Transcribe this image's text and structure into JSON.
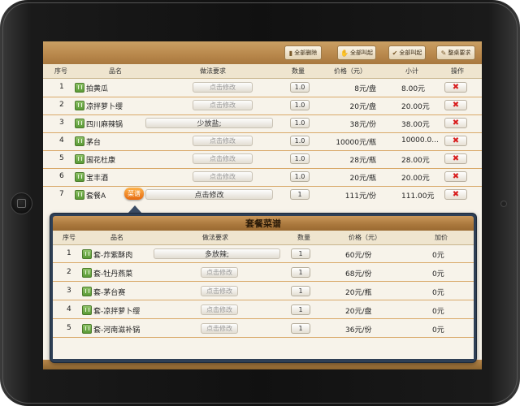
{
  "toolbar": {
    "delete_all": "全部删除",
    "hold_all": "全部叫起",
    "call_all": "全部叫起",
    "table_request": "整桌要求"
  },
  "columns": {
    "no": "序号",
    "name": "品名",
    "request": "做法要求",
    "qty": "数量",
    "price": "价格（元）",
    "subtotal": "小计",
    "action": "操作"
  },
  "orders": [
    {
      "no": "1",
      "name": "拍黄瓜",
      "request": "点击修改",
      "qty": "1.0",
      "price": "8元/盘",
      "subtotal": "8.00元"
    },
    {
      "no": "2",
      "name": "凉拌萝卜缨",
      "request": "点击修改",
      "qty": "1.0",
      "price": "20元/盘",
      "subtotal": "20.00元"
    },
    {
      "no": "3",
      "name": "四川麻辣锅",
      "request": "少放盐;",
      "qty": "1.0",
      "price": "38元/份",
      "subtotal": "38.00元"
    },
    {
      "no": "4",
      "name": "茅台",
      "request": "点击修改",
      "qty": "1.0",
      "price": "10000元/瓶",
      "subtotal": "10000.0..."
    },
    {
      "no": "5",
      "name": "国花杜康",
      "request": "点击修改",
      "qty": "1.0",
      "price": "28元/瓶",
      "subtotal": "28.00元"
    },
    {
      "no": "6",
      "name": "宝丰酒",
      "request": "点击修改",
      "qty": "1.0",
      "price": "20元/瓶",
      "subtotal": "20.00元"
    },
    {
      "no": "7",
      "name": "套餐A",
      "request": "点击修改",
      "qty": "1",
      "price": "111元/份",
      "subtotal": "111.00元",
      "tag": "菜谱"
    }
  ],
  "popup": {
    "title": "套餐菜谱",
    "columns": {
      "no": "序号",
      "name": "品名",
      "request": "做法要求",
      "qty": "数量",
      "price": "价格（元）",
      "add": "加价"
    },
    "items": [
      {
        "no": "1",
        "name": "套-炸紫酥肉",
        "request": "多放辣;",
        "qty": "1",
        "price": "60元/份",
        "add": "0元"
      },
      {
        "no": "2",
        "name": "套-牡丹燕菜",
        "request": "点击修改",
        "qty": "1",
        "price": "68元/份",
        "add": "0元"
      },
      {
        "no": "3",
        "name": "套-茅台赛",
        "request": "点击修改",
        "qty": "1",
        "price": "20元/瓶",
        "add": "0元"
      },
      {
        "no": "4",
        "name": "套-凉拌萝卜缨",
        "request": "点击修改",
        "qty": "1",
        "price": "20元/盘",
        "add": "0元"
      },
      {
        "no": "5",
        "name": "套-河南滋补锅",
        "request": "点击修改",
        "qty": "1",
        "price": "36元/份",
        "add": "0元"
      }
    ]
  },
  "colors": {
    "accent": "#b8874b",
    "delete": "#d81e1e",
    "popup_frame": "#2e3f55"
  }
}
